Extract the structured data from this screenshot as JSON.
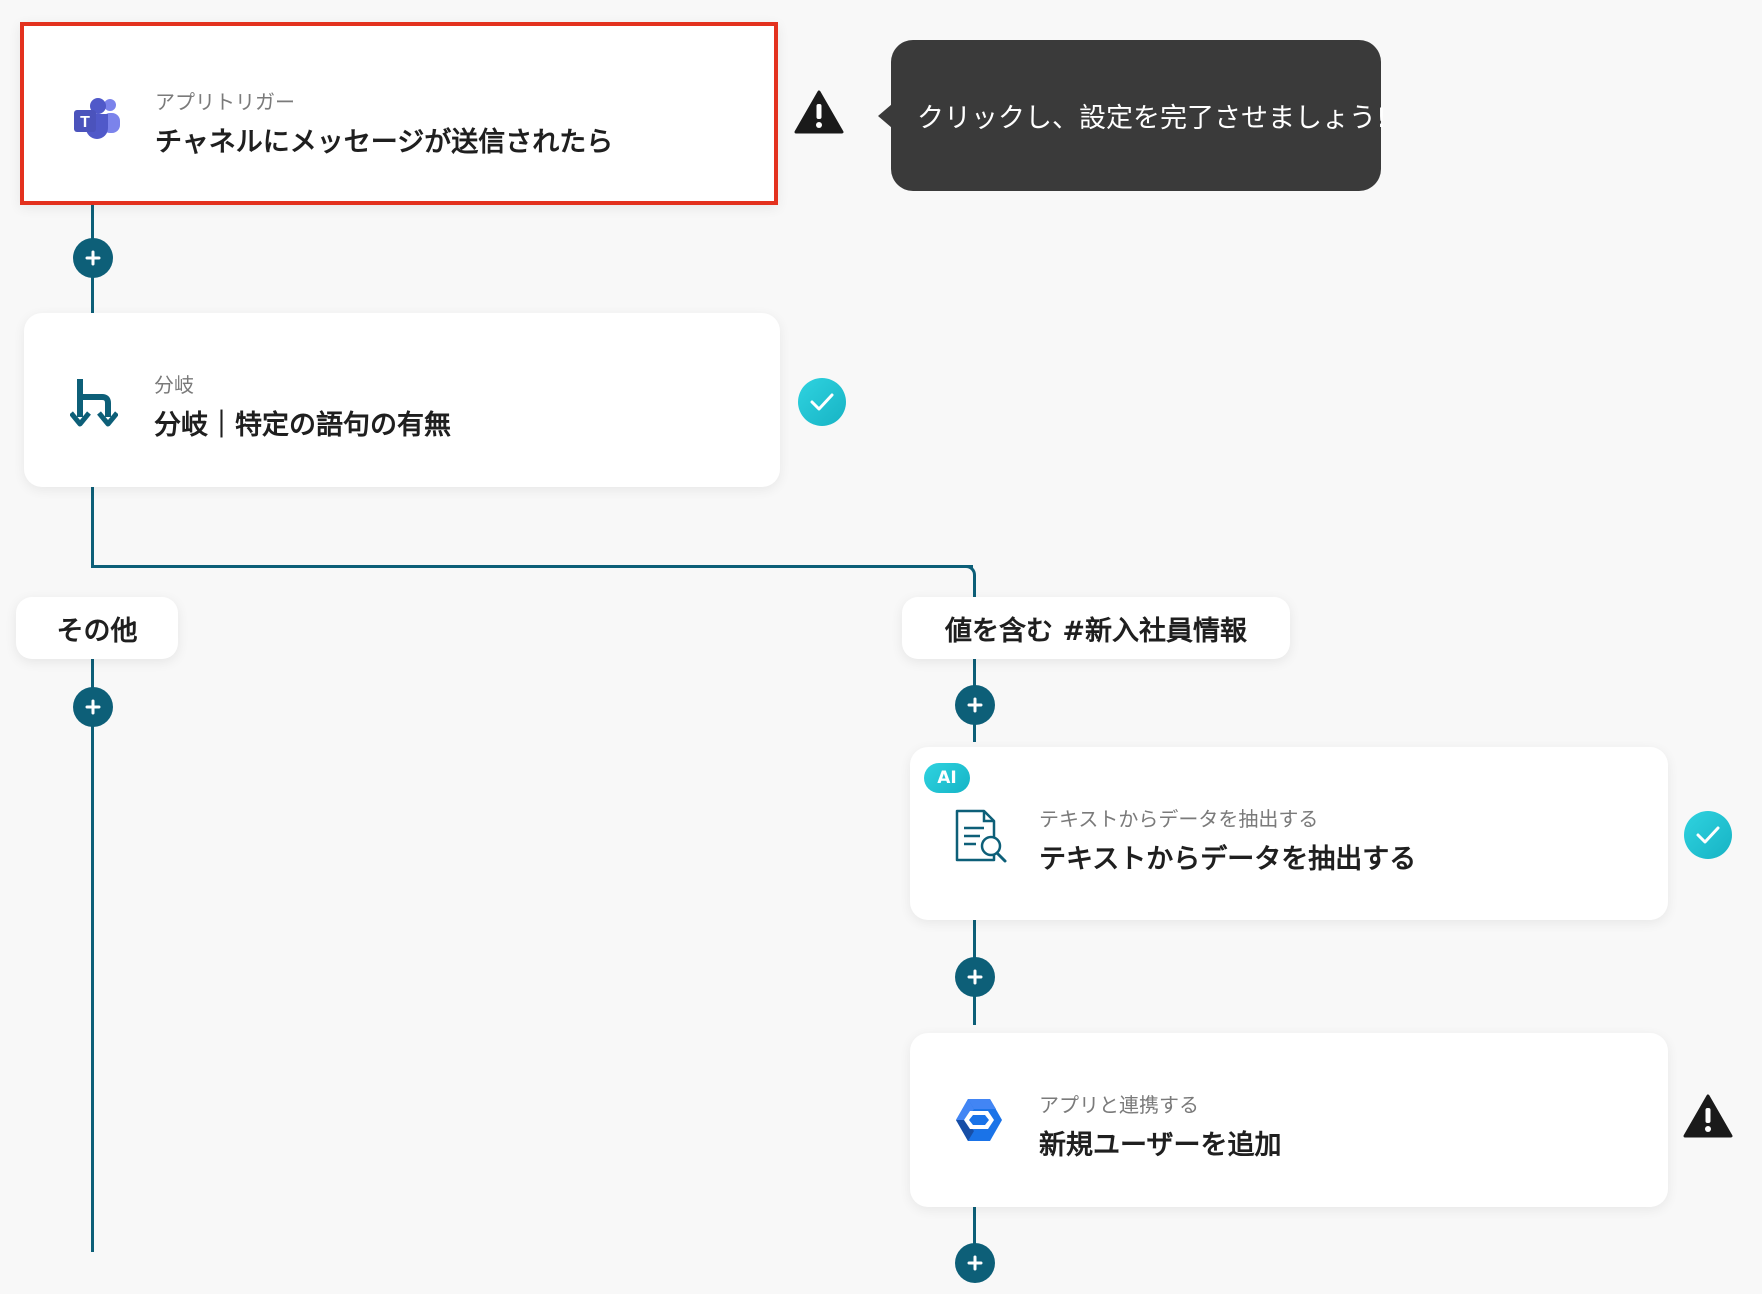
{
  "colors": {
    "connector": "#0d5f78",
    "highlight_border": "#e3311e",
    "check_badge": "#1fc2d2",
    "tooltip_bg": "#3a3a3a"
  },
  "trigger": {
    "subtitle": "アプリトリガー",
    "title": "チャネルにメッセージが送信されたら",
    "icon": "teams-icon",
    "status": "warning"
  },
  "tooltip": {
    "text": "クリックし、設定を完了させましょう!"
  },
  "branch_step": {
    "subtitle": "分岐",
    "title": "分岐｜特定の語句の有無",
    "icon": "branch-icon",
    "status": "complete"
  },
  "branches": {
    "other_label": "その他",
    "match_label": "値を含む #新入社員情報"
  },
  "ai_step": {
    "badge": "AI",
    "subtitle": "テキストからデータを抽出する",
    "title": "テキストからデータを抽出する",
    "icon": "document-search-icon",
    "status": "complete"
  },
  "app_step": {
    "subtitle": "アプリと連携する",
    "title": "新規ユーザーを追加",
    "icon": "google-workspace-icon",
    "status": "warning"
  }
}
